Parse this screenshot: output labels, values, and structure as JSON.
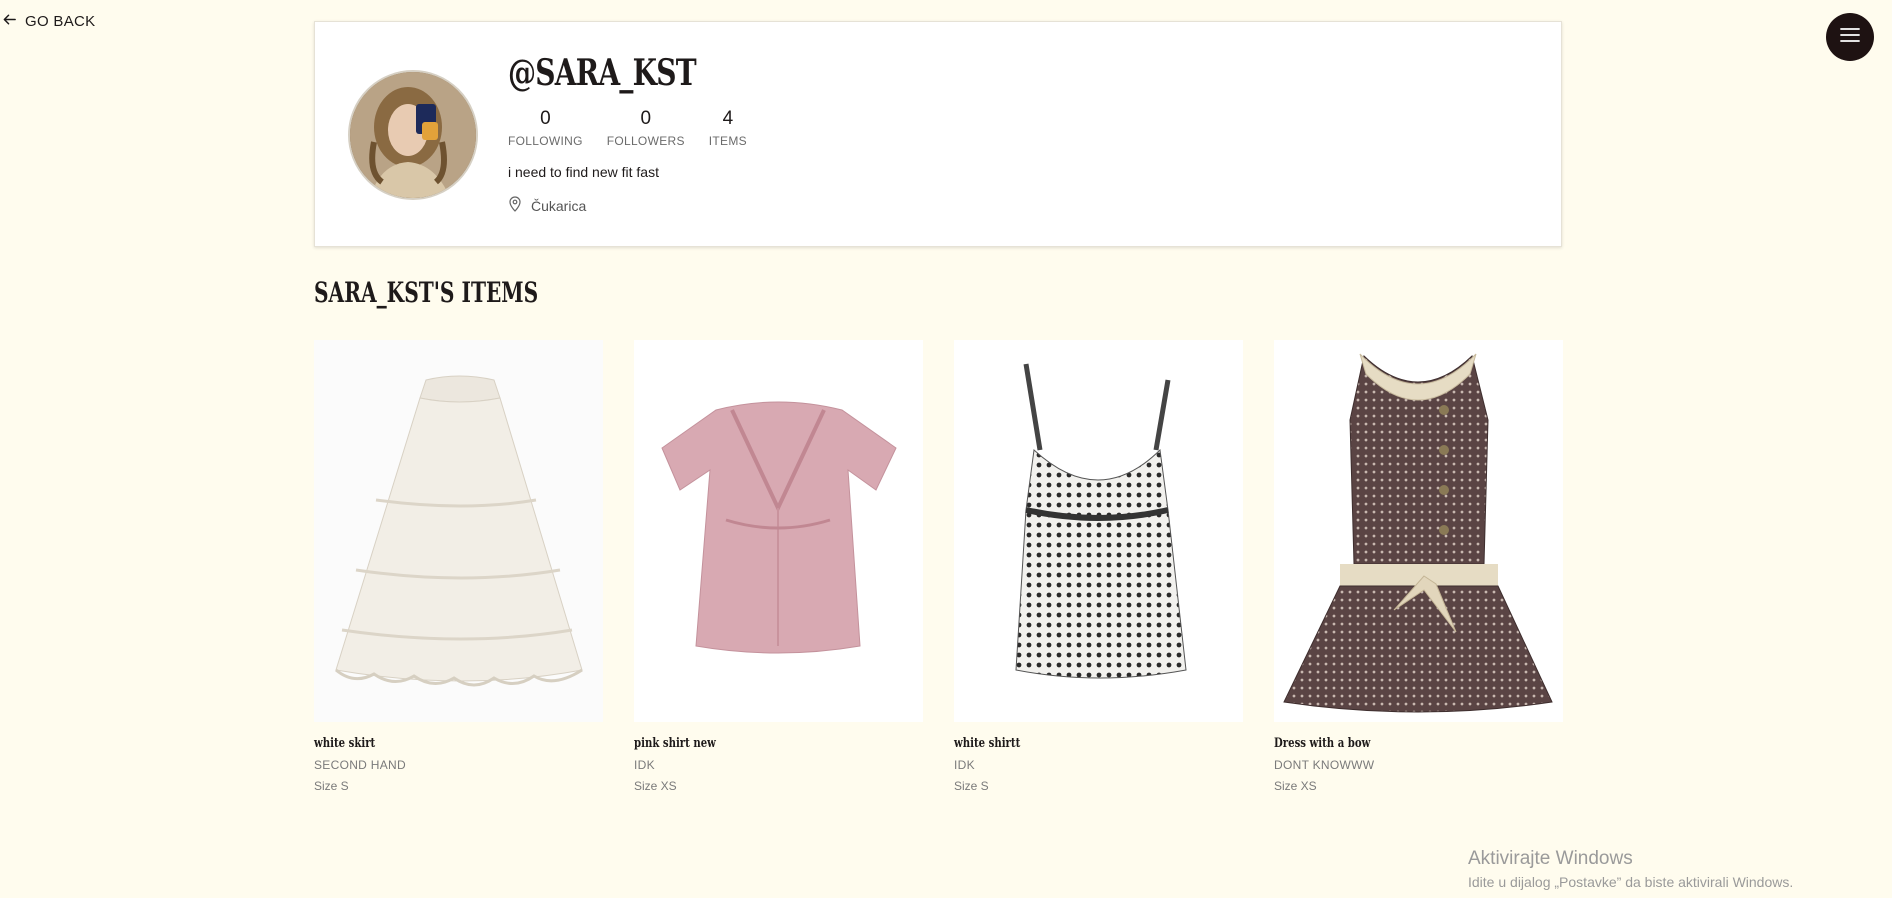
{
  "nav": {
    "back_label": "GO BACK"
  },
  "profile": {
    "username": "@SARA_KST",
    "stats": [
      {
        "value": "0",
        "label": "FOLLOWING"
      },
      {
        "value": "0",
        "label": "FOLLOWERS"
      },
      {
        "value": "4",
        "label": "ITEMS"
      }
    ],
    "bio": "i need to find new fit fast",
    "location": "Čukarica"
  },
  "section": {
    "title": "SARA_KST'S ITEMS"
  },
  "items": [
    {
      "title": "white skirt",
      "condition": "SECOND HAND",
      "size": "Size S"
    },
    {
      "title": "pink shirt new",
      "condition": "IDK",
      "size": "Size XS"
    },
    {
      "title": "white shirtt",
      "condition": "IDK",
      "size": "Size S"
    },
    {
      "title": "Dress with a bow",
      "condition": "DONT KNOWWW",
      "size": "Size XS"
    }
  ],
  "watermark": {
    "line1": "Aktivirajte Windows",
    "line2": "Idite u dijalog „Postavke” da biste aktivirali Windows."
  },
  "colors": {
    "background": "#fffcee",
    "menu_button": "#1e1212",
    "card": "#ffffff"
  },
  "icons": [
    "arrow-left-icon",
    "hamburger-menu-icon",
    "location-pin-icon"
  ]
}
